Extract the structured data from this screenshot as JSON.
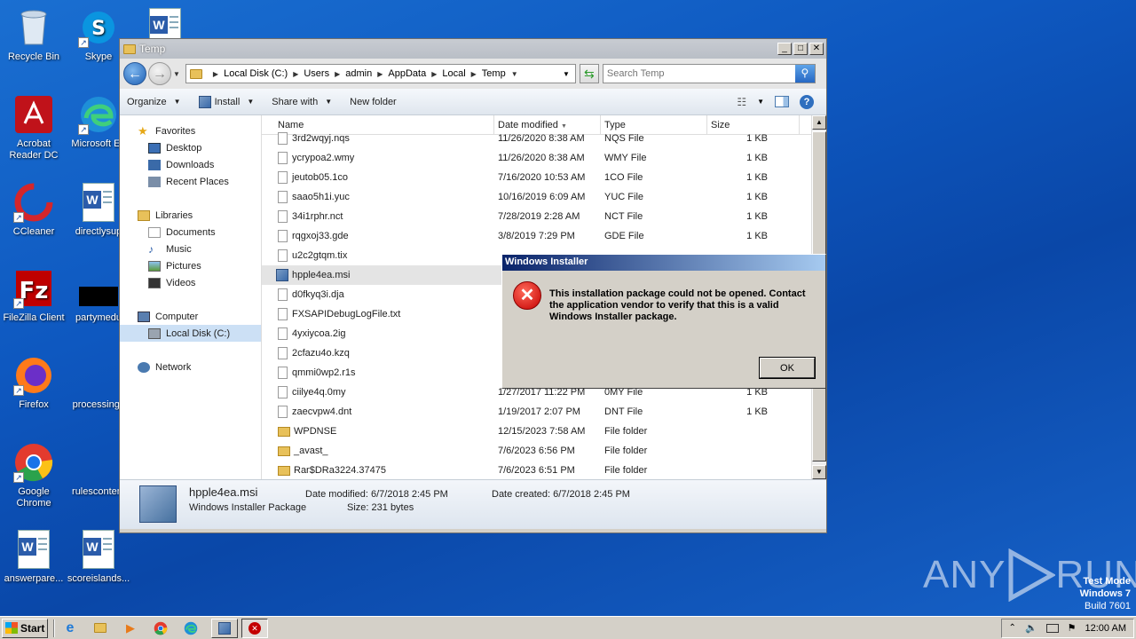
{
  "desktop": {
    "icons": [
      {
        "label": "Recycle Bin"
      },
      {
        "label": "Skype"
      },
      {
        "label": "Acrobat Reader DC"
      },
      {
        "label": "Microsoft Ed"
      },
      {
        "label": "CCleaner"
      },
      {
        "label": "directlysup"
      },
      {
        "label": "FileZilla Client"
      },
      {
        "label": "partymedu"
      },
      {
        "label": "Firefox"
      },
      {
        "label": "processingc"
      },
      {
        "label": "Google Chrome"
      },
      {
        "label": "rulescontent"
      },
      {
        "label": "answerpare..."
      },
      {
        "label": "scoreislands..."
      }
    ]
  },
  "explorer": {
    "title": "Temp",
    "breadcrumbs": [
      "Local Disk (C:)",
      "Users",
      "admin",
      "AppData",
      "Local",
      "Temp"
    ],
    "search_placeholder": "Search Temp",
    "toolbar": {
      "organize": "Organize",
      "install": "Install",
      "share_with": "Share with",
      "new_folder": "New folder"
    },
    "nav": {
      "favorites": "Favorites",
      "desktop": "Desktop",
      "downloads": "Downloads",
      "recent_places": "Recent Places",
      "libraries": "Libraries",
      "documents": "Documents",
      "music": "Music",
      "pictures": "Pictures",
      "videos": "Videos",
      "computer": "Computer",
      "local_disk": "Local Disk (C:)",
      "network": "Network"
    },
    "columns": {
      "name": "Name",
      "date": "Date modified",
      "type": "Type",
      "size": "Size"
    },
    "files": [
      {
        "name": "3rd2wqyj.nqs",
        "date": "11/26/2020 8:38 AM",
        "type": "NQS File",
        "size": "1 KB",
        "kind": "file"
      },
      {
        "name": "ycrypoa2.wmy",
        "date": "11/26/2020 8:38 AM",
        "type": "WMY File",
        "size": "1 KB",
        "kind": "file"
      },
      {
        "name": "jeutob05.1co",
        "date": "7/16/2020 10:53 AM",
        "type": "1CO File",
        "size": "1 KB",
        "kind": "file"
      },
      {
        "name": "saao5h1i.yuc",
        "date": "10/16/2019 6:09 AM",
        "type": "YUC File",
        "size": "1 KB",
        "kind": "file"
      },
      {
        "name": "34i1rphr.nct",
        "date": "7/28/2019 2:28 AM",
        "type": "NCT File",
        "size": "1 KB",
        "kind": "file"
      },
      {
        "name": "rqgxoj33.gde",
        "date": "3/8/2019 7:29 PM",
        "type": "GDE File",
        "size": "1 KB",
        "kind": "file"
      },
      {
        "name": "u2c2gtqm.tix",
        "date": "",
        "type": "",
        "size": "",
        "kind": "file"
      },
      {
        "name": "hpple4ea.msi",
        "date": "",
        "type": "",
        "size": "",
        "kind": "msi"
      },
      {
        "name": "d0fkyq3i.dja",
        "date": "",
        "type": "",
        "size": "",
        "kind": "file"
      },
      {
        "name": "FXSAPIDebugLogFile.txt",
        "date": "",
        "type": "",
        "size": "",
        "kind": "file"
      },
      {
        "name": "4yxiycoa.2ig",
        "date": "",
        "type": "",
        "size": "",
        "kind": "file"
      },
      {
        "name": "2cfazu4o.kzq",
        "date": "",
        "type": "",
        "size": "",
        "kind": "file"
      },
      {
        "name": "qmmi0wp2.r1s",
        "date": "",
        "type": "",
        "size": "",
        "kind": "file"
      },
      {
        "name": "ciilye4q.0my",
        "date": "1/27/2017 11:22 PM",
        "type": "0MY File",
        "size": "1 KB",
        "kind": "file"
      },
      {
        "name": "zaecvpw4.dnt",
        "date": "1/19/2017 2:07 PM",
        "type": "DNT File",
        "size": "1 KB",
        "kind": "file"
      },
      {
        "name": "WPDNSE",
        "date": "12/15/2023 7:58 AM",
        "type": "File folder",
        "size": "",
        "kind": "folder"
      },
      {
        "name": "_avast_",
        "date": "7/6/2023 6:56 PM",
        "type": "File folder",
        "size": "",
        "kind": "folder"
      },
      {
        "name": "Rar$DRa3224.37475",
        "date": "7/6/2023 6:51 PM",
        "type": "File folder",
        "size": "",
        "kind": "folder"
      }
    ],
    "details": {
      "name": "hpple4ea.msi",
      "type": "Windows Installer Package",
      "date_modified_label": "Date modified:",
      "date_modified": "6/7/2018 2:45 PM",
      "size_label": "Size:",
      "size": "231 bytes",
      "date_created_label": "Date created:",
      "date_created": "6/7/2018 2:45 PM"
    }
  },
  "dialog": {
    "title": "Windows Installer",
    "message": "This installation package could not be opened. Contact the application vendor to verify that this is a valid Windows Installer package.",
    "ok": "OK"
  },
  "taskbar": {
    "start": "Start",
    "clock": "12:00 AM"
  },
  "watermark": {
    "text": "ANY RUN"
  },
  "testmode": {
    "line1": "Test Mode",
    "line2": "Windows 7",
    "line3": "Build 7601"
  }
}
